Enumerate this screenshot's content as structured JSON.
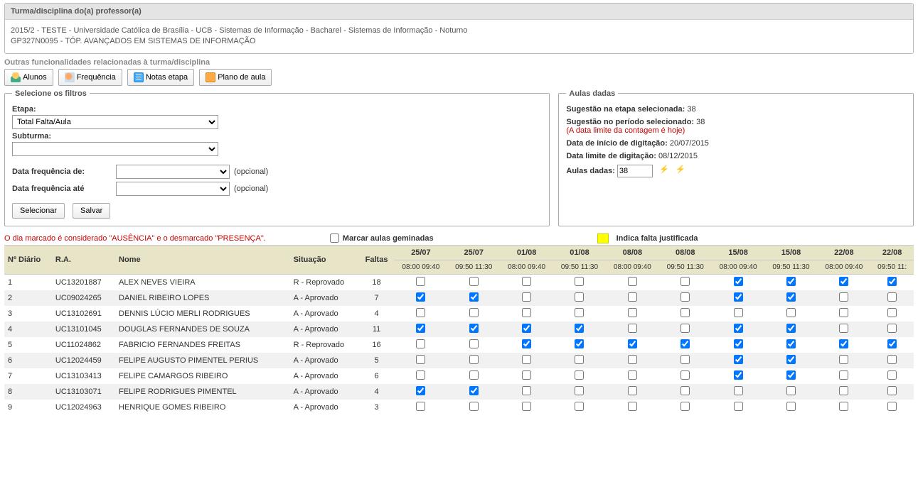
{
  "header": {
    "title": "Turma/disciplina do(a) professor(a)",
    "line1": "2015/2 - TESTE - Universidade Católica de Brasília - UCB - Sistemas de Informação - Bacharel - Sistemas de Informação - Noturno",
    "line2": "GP327N0095 - TÓP. AVANÇADOS EM SISTEMAS DE INFORMAÇÃO"
  },
  "subtitle": "Outras funcionalidades relacionadas à turma/disciplina",
  "toolbar": {
    "alunos": "Alunos",
    "frequencia": "Frequência",
    "notas": "Notas etapa",
    "plano": "Plano de aula"
  },
  "filters": {
    "legend": "Selecione os filtros",
    "etapa_label": "Etapa:",
    "etapa_value": "Total Falta/Aula",
    "subturma_label": "Subturma:",
    "subturma_value": "",
    "data_de_label": "Data frequência de:",
    "data_ate_label": "Data frequência até",
    "opcional": "(opcional)",
    "selecionar": "Selecionar",
    "salvar": "Salvar"
  },
  "aulas": {
    "legend": "Aulas dadas",
    "sugestao_etapa_label": "Sugestão na etapa selecionada:",
    "sugestao_etapa_value": "38",
    "sugestao_periodo_label": "Sugestão no período selecionado:",
    "sugestao_periodo_value": "38",
    "limite_nota": "(A data limite da contagem é hoje)",
    "inicio_label": "Data de início de digitação:",
    "inicio_value": "20/07/2015",
    "limite_label": "Data limite de digitação:",
    "limite_value": "08/12/2015",
    "aulas_dadas_label": "Aulas dadas:",
    "aulas_dadas_value": "38"
  },
  "legend_row": {
    "note": "O dia marcado é considerado \"AUSÊNCIA\" e o desmarcado \"PRESENÇA\".",
    "marcar": "Marcar aulas geminadas",
    "indica": "Indica falta justificada"
  },
  "table": {
    "cols": {
      "diario": "Nº Diário",
      "ra": "R.A.",
      "nome": "Nome",
      "situacao": "Situação",
      "faltas": "Faltas"
    },
    "dates": [
      "25/07",
      "25/07",
      "01/08",
      "01/08",
      "08/08",
      "08/08",
      "15/08",
      "15/08",
      "22/08",
      "22/08"
    ],
    "times": [
      "08:00 09:40",
      "09:50 11:30",
      "08:00 09:40",
      "09:50 11:30",
      "08:00 09:40",
      "09:50 11:30",
      "08:00 09:40",
      "09:50 11:30",
      "08:00 09:40",
      "09:50 11:"
    ],
    "rows": [
      {
        "n": "1",
        "ra": "UC13201887",
        "nome": "ALEX NEVES VIEIRA",
        "sit": "R - Reprovado",
        "faltas": "18",
        "chk": [
          false,
          false,
          false,
          false,
          false,
          false,
          true,
          true,
          true,
          true
        ]
      },
      {
        "n": "2",
        "ra": "UC09024265",
        "nome": "DANIEL RIBEIRO LOPES",
        "sit": "A - Aprovado",
        "faltas": "7",
        "chk": [
          true,
          true,
          false,
          false,
          false,
          false,
          true,
          true,
          false,
          false
        ]
      },
      {
        "n": "3",
        "ra": "UC13102691",
        "nome": "DENNIS LÚCIO MERLI RODRIGUES",
        "sit": "A - Aprovado",
        "faltas": "4",
        "chk": [
          false,
          false,
          false,
          false,
          false,
          false,
          false,
          false,
          false,
          false
        ]
      },
      {
        "n": "4",
        "ra": "UC13101045",
        "nome": "DOUGLAS FERNANDES DE SOUZA",
        "sit": "A - Aprovado",
        "faltas": "11",
        "chk": [
          true,
          true,
          true,
          true,
          false,
          false,
          true,
          true,
          false,
          false
        ]
      },
      {
        "n": "5",
        "ra": "UC11024862",
        "nome": "FABRICIO FERNANDES FREITAS",
        "sit": "R - Reprovado",
        "faltas": "16",
        "chk": [
          false,
          false,
          true,
          true,
          true,
          true,
          true,
          true,
          true,
          true
        ]
      },
      {
        "n": "6",
        "ra": "UC12024459",
        "nome": "FELIPE AUGUSTO PIMENTEL PERIUS",
        "sit": "A - Aprovado",
        "faltas": "5",
        "chk": [
          false,
          false,
          false,
          false,
          false,
          false,
          true,
          true,
          false,
          false
        ]
      },
      {
        "n": "7",
        "ra": "UC13103413",
        "nome": "FELIPE CAMARGOS RIBEIRO",
        "sit": "A - Aprovado",
        "faltas": "6",
        "chk": [
          false,
          false,
          false,
          false,
          false,
          false,
          true,
          true,
          false,
          false
        ]
      },
      {
        "n": "8",
        "ra": "UC13103071",
        "nome": "FELIPE RODRIGUES PIMENTEL",
        "sit": "A - Aprovado",
        "faltas": "4",
        "chk": [
          true,
          true,
          false,
          false,
          false,
          false,
          false,
          false,
          false,
          false
        ]
      },
      {
        "n": "9",
        "ra": "UC12024963",
        "nome": "HENRIQUE GOMES RIBEIRO",
        "sit": "A - Aprovado",
        "faltas": "3",
        "chk": [
          false,
          false,
          false,
          false,
          false,
          false,
          false,
          false,
          false,
          false
        ]
      }
    ]
  }
}
